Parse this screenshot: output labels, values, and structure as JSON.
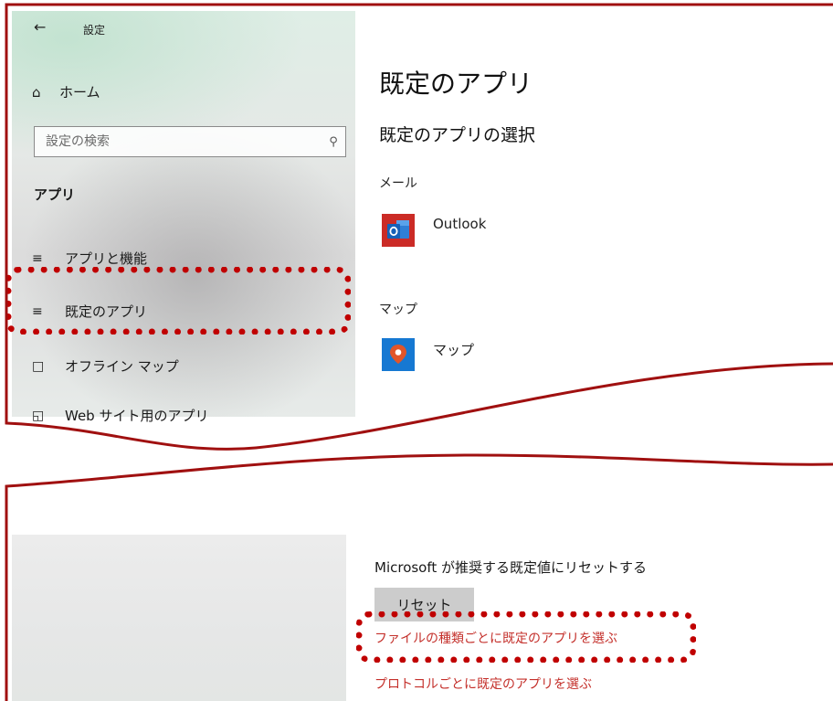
{
  "header": {
    "back_icon": "arrow-left-icon",
    "title": "設定"
  },
  "sidebar": {
    "home": {
      "icon": "home-icon",
      "label": "ホーム"
    },
    "search": {
      "placeholder": "設定の検索",
      "icon": "search-icon"
    },
    "section_title": "アプリ",
    "items": [
      {
        "icon": "list-icon",
        "label": "アプリと機能"
      },
      {
        "icon": "list-default-icon",
        "label": "既定のアプリ",
        "selected": true
      },
      {
        "icon": "offline-map-icon",
        "label": "オフライン マップ"
      },
      {
        "icon": "web-app-icon",
        "label": "Web サイト用のアプリ"
      }
    ]
  },
  "main": {
    "title": "既定のアプリ",
    "subtitle": "既定のアプリの選択",
    "categories": [
      {
        "label": "メール",
        "app": {
          "name": "Outlook",
          "icon": "outlook-icon",
          "color": "#cb2b26"
        }
      },
      {
        "label": "マップ",
        "app": {
          "name": "マップ",
          "icon": "maps-icon",
          "color": "#1678d2"
        }
      }
    ],
    "reset": {
      "label": "Microsoft が推奨する既定値にリセットする",
      "button": "リセット"
    },
    "links": [
      {
        "label": "ファイルの種類ごとに既定のアプリを選ぶ",
        "highlighted": true
      },
      {
        "label": "プロトコルごとに既定のアプリを選ぶ"
      }
    ]
  },
  "colors": {
    "frame": "#a01010",
    "highlight": "#c00000",
    "link": "#c4302b",
    "button": "#cccccc"
  }
}
